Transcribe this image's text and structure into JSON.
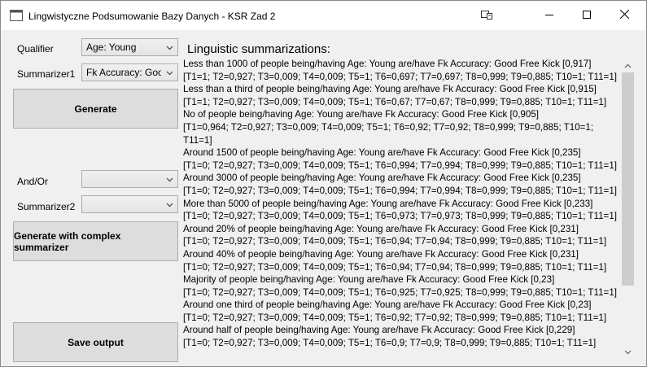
{
  "window": {
    "title": "Lingwistyczne Podsumowanie Bazy Danych - KSR Zad 2"
  },
  "form": {
    "qualifier_label": "Qualifier",
    "qualifier_value": "Age: Young",
    "summarizer1_label": "Summarizer1",
    "summarizer1_value": "Fk Accuracy: Good",
    "generate_label": "Generate",
    "andor_label": "And/Or",
    "andor_value": "",
    "summarizer2_label": "Summarizer2",
    "summarizer2_value": "",
    "generate_complex_label": "Generate with complex summarizer",
    "save_label": "Save output"
  },
  "results": {
    "heading": "Linguistic summarizations:",
    "lines": [
      "Less than 1000 of people being/having Age: Young are/have Fk Accuracy: Good Free Kick [0,917]",
      "[T1=1; T2=0,927; T3=0,009; T4=0,009; T5=1; T6=0,697; T7=0,697; T8=0,999; T9=0,885; T10=1; T11=1]",
      "Less than a third of people being/having Age: Young are/have Fk Accuracy: Good Free Kick [0,915]",
      "[T1=1; T2=0,927; T3=0,009; T4=0,009; T5=1; T6=0,67; T7=0,67; T8=0,999; T9=0,885; T10=1; T11=1]",
      "No of people being/having Age: Young are/have Fk Accuracy: Good Free Kick [0,905]",
      "[T1=0,964; T2=0,927; T3=0,009; T4=0,009; T5=1; T6=0,92; T7=0,92; T8=0,999; T9=0,885; T10=1;",
      "T11=1]",
      "Around 1500 of people being/having Age: Young are/have Fk Accuracy: Good Free Kick [0,235]",
      "[T1=0; T2=0,927; T3=0,009; T4=0,009; T5=1; T6=0,994; T7=0,994; T8=0,999; T9=0,885; T10=1; T11=1]",
      "Around 3000 of people being/having Age: Young are/have Fk Accuracy: Good Free Kick [0,235]",
      "[T1=0; T2=0,927; T3=0,009; T4=0,009; T5=1; T6=0,994; T7=0,994; T8=0,999; T9=0,885; T10=1; T11=1]",
      "More than 5000 of people being/having Age: Young are/have Fk Accuracy: Good Free Kick [0,233]",
      "[T1=0; T2=0,927; T3=0,009; T4=0,009; T5=1; T6=0,973; T7=0,973; T8=0,999; T9=0,885; T10=1; T11=1]",
      "Around 20% of people being/having Age: Young are/have Fk Accuracy: Good Free Kick [0,231]",
      "[T1=0; T2=0,927; T3=0,009; T4=0,009; T5=1; T6=0,94; T7=0,94; T8=0,999; T9=0,885; T10=1; T11=1]",
      "Around 40% of people being/having Age: Young are/have Fk Accuracy: Good Free Kick [0,231]",
      "[T1=0; T2=0,927; T3=0,009; T4=0,009; T5=1; T6=0,94; T7=0,94; T8=0,999; T9=0,885; T10=1; T11=1]",
      "Majority of people being/having Age: Young are/have Fk Accuracy: Good Free Kick [0,23]",
      "[T1=0; T2=0,927; T3=0,009; T4=0,009; T5=1; T6=0,925; T7=0,925; T8=0,999; T9=0,885; T10=1; T11=1]",
      "Around one third of people being/having Age: Young are/have Fk Accuracy: Good Free Kick [0,23]",
      "[T1=0; T2=0,927; T3=0,009; T4=0,009; T5=1; T6=0,92; T7=0,92; T8=0,999; T9=0,885; T10=1; T11=1]",
      "Around half of people being/having Age: Young are/have Fk Accuracy: Good Free Kick [0,229]",
      "[T1=0; T2=0,927; T3=0,009; T4=0,009; T5=1; T6=0,9; T7=0,9; T8=0,999; T9=0,885; T10=1; T11=1]"
    ]
  }
}
